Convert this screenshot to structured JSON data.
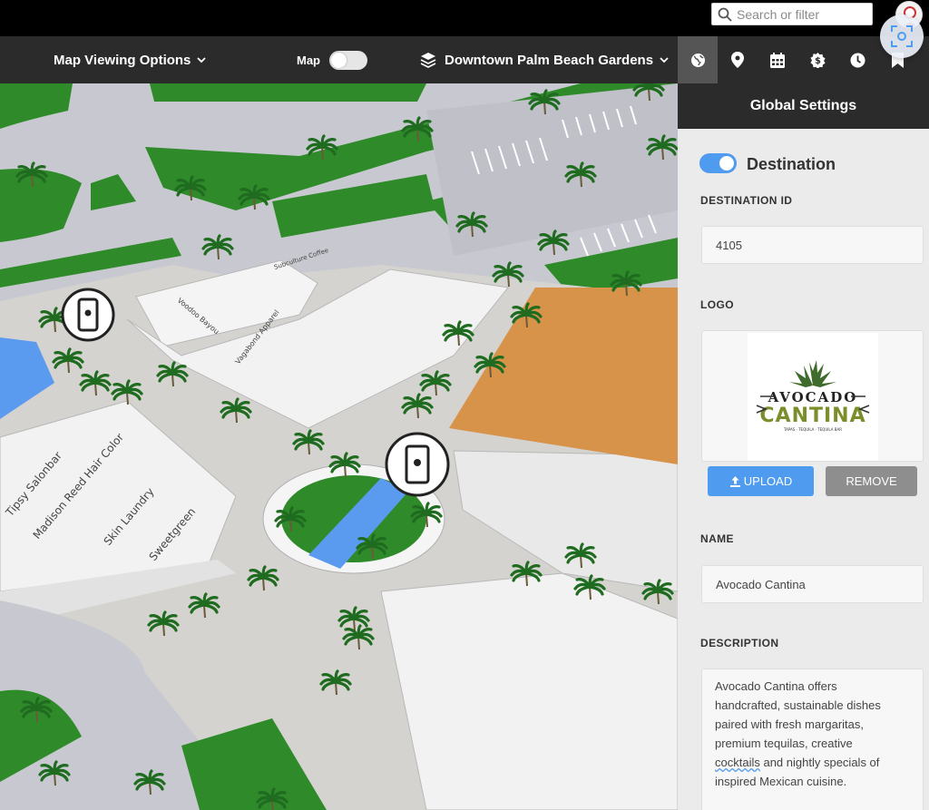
{
  "search": {
    "placeholder": "Search or filter"
  },
  "nav": {
    "viewing_options": "Map Viewing Options",
    "map_toggle_label": "Map",
    "location": "Downtown Palm Beach Gardens",
    "tabs": [
      "globe-icon",
      "map-pin-icon",
      "calendar-icon",
      "dollar-icon",
      "clock-icon",
      "bookmark-icon"
    ]
  },
  "map": {
    "labels": [
      "Subculture Coffee",
      "Voodoo Bayou",
      "Vagabond Apparel",
      "Tipsy Salonbar",
      "Madison Reed Hair Color",
      "Skin Laundry",
      "Sweetgreen"
    ]
  },
  "panel": {
    "title": "Global Settings",
    "destination_toggle": "Destination",
    "destination_id_label": "DESTINATION ID",
    "destination_id": "4105",
    "logo_label": "LOGO",
    "logo_text": {
      "top": "AVOCADO",
      "bottom": "CANTINA",
      "tag": "TAPAS · TEQUILA · TEQUILA BAR"
    },
    "upload_label": "UPLOAD",
    "remove_label": "REMOVE",
    "name_label": "NAME",
    "name": "Avocado Cantina",
    "description_label": "DESCRIPTION",
    "description_lines": [
      "Avocado Cantina offers",
      "handcrafted, sustainable dishes",
      "paired with fresh margaritas,",
      "premium tequilas, creative",
      "nightly specials of",
      "inspired Mexican cuisine."
    ],
    "description_word": "cocktails"
  },
  "colors": {
    "accent": "#4f9bf0",
    "nav_bg": "#2b2b2b",
    "grass": "#2f8a2a",
    "road": "#bfc0c8",
    "water": "#5b9bef",
    "building_orange": "#d8934a"
  }
}
